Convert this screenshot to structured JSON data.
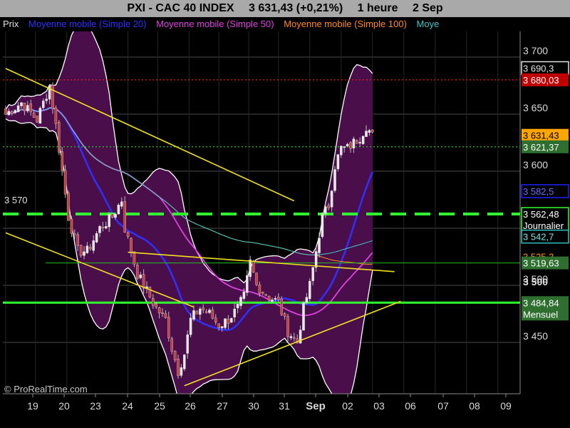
{
  "header": {
    "instrument": "PXI - CAC 40 INDEX",
    "last": "3 631,43 (+0,21%)",
    "period": "1 heure",
    "date": "2 Sep"
  },
  "legend": [
    {
      "label": "Prix",
      "color": "#e0e0e0"
    },
    {
      "label": "Moyenne mobile (Simple 20)",
      "color": "#2f2fff"
    },
    {
      "label": "Moyenne mobile (Simple 50)",
      "color": "#e040e0"
    },
    {
      "label": "Moyenne mobile (Simple 100)",
      "color": "#ff8c1a"
    },
    {
      "label": "Moye",
      "color": "#3fc9c9"
    }
  ],
  "watermark": "© ProRealTime.com",
  "chart_data": {
    "type": "candlestick",
    "x_ticks": [
      "19",
      "20",
      "23",
      "24",
      "25",
      "26",
      "27",
      "30",
      "31",
      "Sep",
      "02",
      "03",
      "06",
      "07",
      "08",
      "09"
    ],
    "y_ticks": [
      3450,
      3500,
      3550,
      3600,
      3650,
      3700
    ],
    "y_tick_labels": [
      "3 450",
      "3 500",
      "3 550",
      "3 600",
      "3 650",
      "3 700"
    ],
    "ylim": [
      3402,
      3730
    ],
    "n_bars": 120,
    "price_annotations": [
      {
        "value": 3690.3,
        "text": "3 690,3"
      },
      {
        "value": 3680.03,
        "text": "3 680,03"
      },
      {
        "value": 3631.43,
        "text": "3 631,43"
      },
      {
        "value": 3621.37,
        "text": "3 621,37"
      },
      {
        "value": 3582.5,
        "text": "3 582,5"
      },
      {
        "value": 3562.48,
        "text": "3 562,48",
        "label": "Journalier"
      },
      {
        "value": 3542.7,
        "text": "3 542,7"
      },
      {
        "value": 3525.3,
        "text": "3 525,3"
      },
      {
        "value": 3519.63,
        "text": "3 519,63"
      },
      {
        "value": 3484.84,
        "text": "3 484,84",
        "label": "Mensuel"
      },
      {
        "value": 3570,
        "text": "3 570"
      },
      {
        "value": 3500,
        "text": "3 500"
      }
    ],
    "horizontal_levels": [
      {
        "value": 3680.03,
        "color": "#ff2020",
        "style": "dotted"
      },
      {
        "value": 3621.37,
        "color": "#20e020",
        "style": "dotted"
      },
      {
        "value": 3562.48,
        "color": "#30ff30",
        "style": "dashed-thick"
      },
      {
        "value": 3519.63,
        "color": "#20c020",
        "style": "thin"
      },
      {
        "value": 3484.84,
        "color": "#30ff30",
        "style": "thick"
      }
    ],
    "trendlines": [
      {
        "points": [
          [
            0,
            3690
          ],
          [
            92,
            3574
          ]
        ]
      },
      {
        "points": [
          [
            0,
            3546
          ],
          [
            60,
            3481
          ]
        ]
      },
      {
        "points": [
          [
            39,
            3529
          ],
          [
            124,
            3512
          ]
        ]
      },
      {
        "points": [
          [
            57,
            3412
          ],
          [
            126,
            3486
          ]
        ]
      }
    ],
    "anchors_close": [
      [
        0,
        3650
      ],
      [
        5,
        3660
      ],
      [
        10,
        3645
      ],
      [
        14,
        3675
      ],
      [
        16,
        3640
      ],
      [
        18,
        3600
      ],
      [
        20,
        3560
      ],
      [
        23,
        3530
      ],
      [
        26,
        3530
      ],
      [
        30,
        3550
      ],
      [
        34,
        3560
      ],
      [
        37,
        3575
      ],
      [
        38,
        3550
      ],
      [
        40,
        3530
      ],
      [
        42,
        3510
      ],
      [
        45,
        3495
      ],
      [
        48,
        3480
      ],
      [
        51,
        3470
      ],
      [
        53,
        3445
      ],
      [
        55,
        3425
      ],
      [
        57,
        3440
      ],
      [
        59,
        3470
      ],
      [
        62,
        3480
      ],
      [
        65,
        3475
      ],
      [
        68,
        3465
      ],
      [
        71,
        3470
      ],
      [
        74,
        3480
      ],
      [
        76,
        3490
      ],
      [
        78,
        3520
      ],
      [
        80,
        3500
      ],
      [
        84,
        3490
      ],
      [
        87,
        3485
      ],
      [
        90,
        3460
      ],
      [
        93,
        3450
      ],
      [
        95,
        3480
      ],
      [
        97,
        3500
      ],
      [
        99,
        3530
      ],
      [
        101,
        3560
      ],
      [
        103,
        3570
      ],
      [
        105,
        3605
      ],
      [
        107,
        3620
      ],
      [
        109,
        3620
      ],
      [
        111,
        3625
      ],
      [
        113,
        3630
      ],
      [
        115,
        3640
      ],
      [
        117,
        3631
      ]
    ],
    "series": [
      {
        "name": "Moyenne mobile (Simple 20)",
        "period": 20,
        "color": "#2f2fff",
        "width": 2.5
      },
      {
        "name": "Moyenne mobile (Simple 50)",
        "period": 50,
        "color": "#e040e0",
        "width": 1.8
      },
      {
        "name": "Moyenne mobile (Simple 100)",
        "period": 100,
        "color": "#ff8c1a",
        "width": 1
      },
      {
        "period": 150,
        "color": "#3fc9c9",
        "width": 1
      }
    ],
    "bollinger": {
      "fill": "#4a0f4a",
      "edge": "#ffffff"
    },
    "colors": {
      "up": "#e8e8e8",
      "down": "#c04040",
      "grid": "#3a3a3a",
      "text": "#d8d8d8"
    }
  }
}
